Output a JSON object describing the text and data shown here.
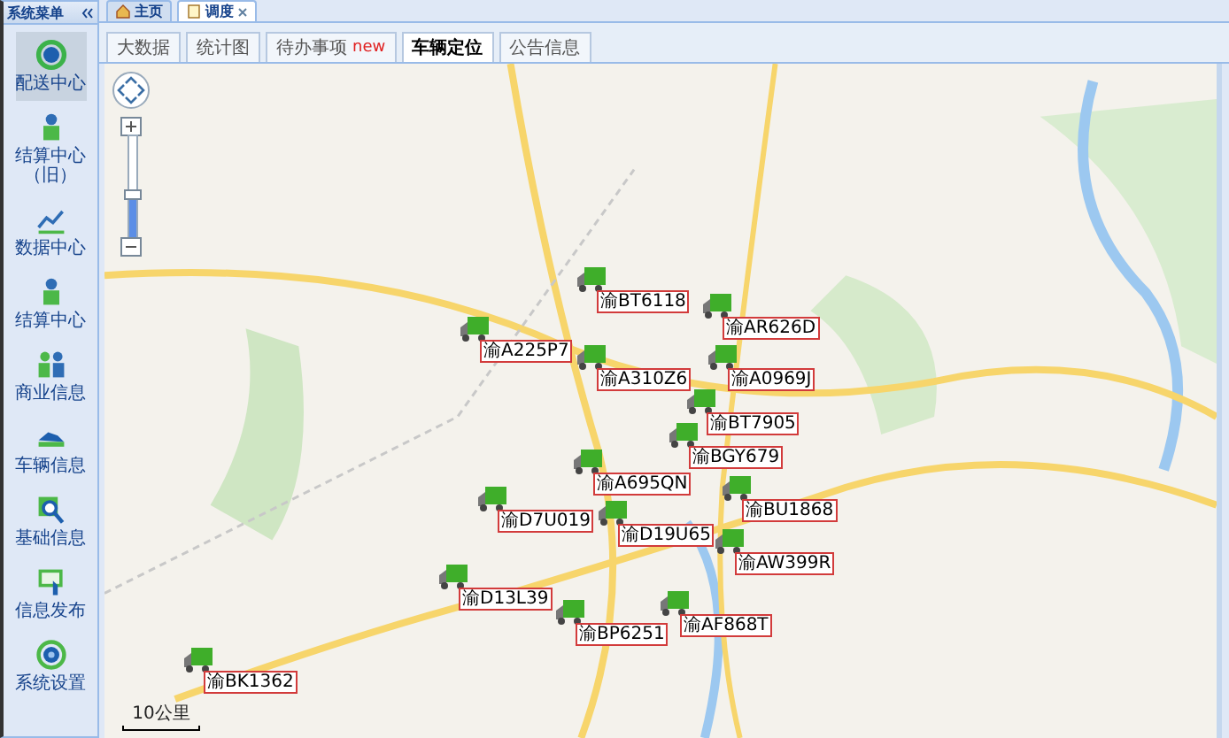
{
  "sidebar": {
    "title": "系统菜单",
    "items": [
      {
        "label": "配送中心",
        "selected": true
      },
      {
        "label": "结算中心（旧）",
        "selected": false
      },
      {
        "label": "数据中心",
        "selected": false
      },
      {
        "label": "结算中心",
        "selected": false
      },
      {
        "label": "商业信息",
        "selected": false
      },
      {
        "label": "车辆信息",
        "selected": false
      },
      {
        "label": "基础信息",
        "selected": false
      },
      {
        "label": "信息发布",
        "selected": false
      },
      {
        "label": "系统设置",
        "selected": false
      }
    ]
  },
  "main_tabs": [
    {
      "label": "主页",
      "selected": false,
      "closable": false
    },
    {
      "label": "调度",
      "selected": true,
      "closable": true
    }
  ],
  "sub_tabs": [
    {
      "label": "大数据",
      "selected": false
    },
    {
      "label": "统计图",
      "selected": false
    },
    {
      "label": "待办事项",
      "badge": "new",
      "selected": false
    },
    {
      "label": "车辆定位",
      "selected": true
    },
    {
      "label": "公告信息",
      "selected": false
    }
  ],
  "map": {
    "zoom": {
      "level": 0.45
    },
    "scale": "10公里",
    "vehicles": [
      {
        "plate": "渝BT6118"
      },
      {
        "plate": "渝AR626D"
      },
      {
        "plate": "渝A225P7"
      },
      {
        "plate": "渝A310Z6"
      },
      {
        "plate": "渝A0969J"
      },
      {
        "plate": "渝BT7905"
      },
      {
        "plate": "渝BGY679"
      },
      {
        "plate": "渝A695QN"
      },
      {
        "plate": "渝BU1868"
      },
      {
        "plate": "渝D19U65"
      },
      {
        "plate": "渝D7U019"
      },
      {
        "plate": "渝AW399R"
      },
      {
        "plate": "渝D13L39"
      },
      {
        "plate": "渝BP6251"
      },
      {
        "plate": "渝AF868T"
      },
      {
        "plate": "渝BK1362"
      }
    ]
  }
}
